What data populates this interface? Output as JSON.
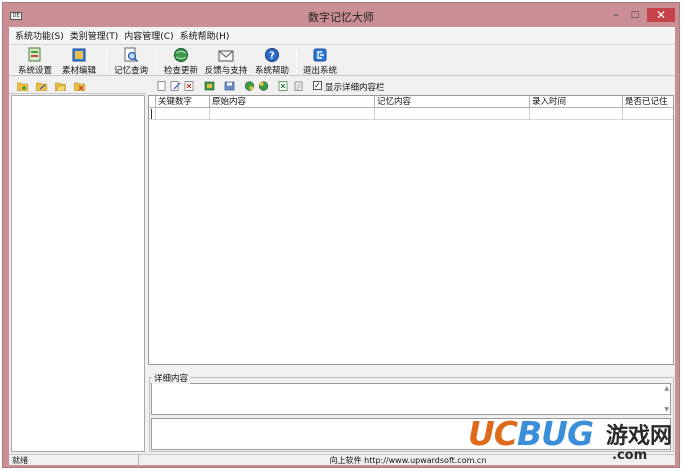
{
  "window": {
    "title": "数字记忆大师",
    "icon_text": "DE",
    "controls": {
      "minimize": "–",
      "maximize": "□",
      "close": "✕"
    }
  },
  "menu": {
    "items": [
      {
        "label": "系统功能(S)"
      },
      {
        "label": "类别管理(T)"
      },
      {
        "label": "内容管理(C)"
      },
      {
        "label": "系统帮助(H)"
      }
    ]
  },
  "toolbar": {
    "buttons": [
      {
        "label": "系统设置",
        "icon": "settings-icon"
      },
      {
        "label": "素材编辑",
        "icon": "edit-material-icon"
      },
      {
        "label": "记忆查询",
        "icon": "search-memory-icon"
      },
      {
        "label": "检查更新",
        "icon": "update-globe-icon"
      },
      {
        "label": "反馈与支持",
        "icon": "feedback-envelope-icon"
      },
      {
        "label": "系统帮助",
        "icon": "help-icon"
      },
      {
        "label": "退出系统",
        "icon": "exit-icon"
      }
    ]
  },
  "left_toolbar": {
    "icons": [
      "add-folder-icon",
      "edit-folder-icon",
      "open-folder-icon",
      "delete-folder-icon"
    ]
  },
  "content_toolbar": {
    "icons": [
      "new-icon",
      "edit-icon",
      "delete-icon",
      "move-icon",
      "save-icon",
      "import-icon",
      "export-icon",
      "excel-icon",
      "clipboard-icon"
    ],
    "show_detail_label": "显示详细内容栏",
    "show_detail_checked": true
  },
  "grid": {
    "columns": [
      "关键数字",
      "原始内容",
      "记忆内容",
      "录入时间",
      "是否已记住"
    ],
    "rows": [
      [
        "",
        "",
        "",
        "",
        ""
      ]
    ]
  },
  "detail": {
    "legend": "详细内容"
  },
  "status": {
    "left": "就绪",
    "right": "向上软件  http://www.upwardsoft.com.cn"
  },
  "watermark": {
    "logo_a": "UC",
    "logo_b": "BUG",
    "text": "游戏网",
    "domain": ".com"
  },
  "colors": {
    "title_bar": "#c98f95",
    "close_button": "#c7434b",
    "accent_blue": "#3a8fd8",
    "accent_orange": "#e06a1a"
  }
}
